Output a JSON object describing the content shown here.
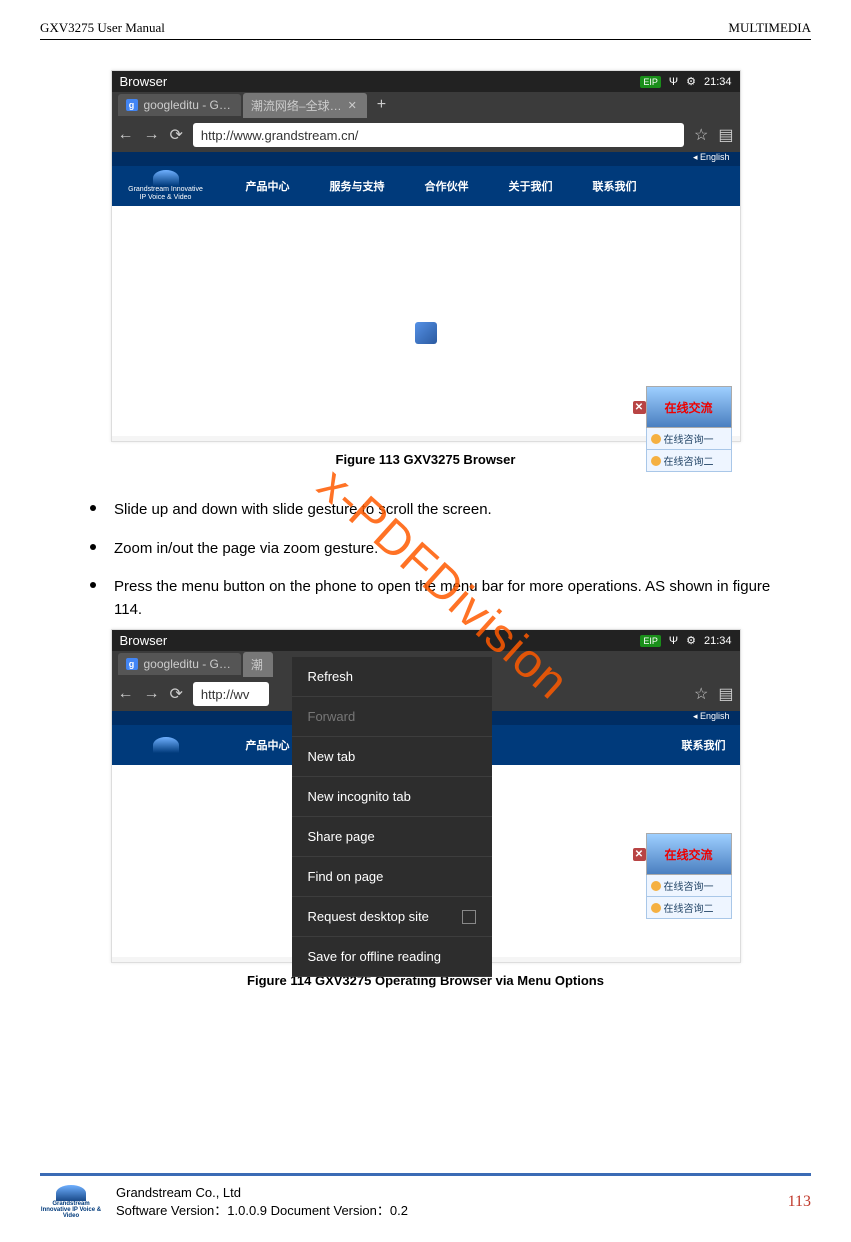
{
  "header": {
    "left": "GXV3275 User Manual",
    "right": "MULTIMEDIA"
  },
  "watermark": "x-PDFDivision",
  "screenshot1": {
    "app_title": "Browser",
    "time": "21:34",
    "eip_badge": "EIP",
    "tabs": [
      {
        "label": "googleditu - G…",
        "active": false,
        "icon": "g"
      },
      {
        "label": "潮流网络–全球…",
        "active": true
      }
    ],
    "url": "http://www.grandstream.cn/",
    "lang_label": "English",
    "site_nav": [
      "产品中心",
      "服务与支持",
      "合作伙伴",
      "关于我们",
      "联系我们"
    ],
    "logo_text": "Grandstream\nInnovative IP Voice & Video",
    "callout": {
      "title": "在线交流",
      "items": [
        "在线咨询一",
        "在线咨询二"
      ]
    }
  },
  "fig1_caption": "Figure 113 GXV3275 Browser",
  "bullets": [
    "Slide up and down with slide gesture to scroll the screen.",
    "Zoom in/out the page via zoom gesture.",
    "Press the menu button on the phone to open the menu bar for more operations. AS shown in figure 114."
  ],
  "screenshot2": {
    "app_title": "Browser",
    "time": "21:34",
    "eip_badge": "EIP",
    "tab_label": "googleditu - G…",
    "tab2_prefix": "潮",
    "url_prefix": "http://wv",
    "nav_first": "产品中心",
    "nav_last": "联系我们",
    "lang_label": "English",
    "menu": [
      {
        "label": "Refresh",
        "disabled": false
      },
      {
        "label": "Forward",
        "disabled": true
      },
      {
        "label": "New tab",
        "disabled": false
      },
      {
        "label": "New incognito tab",
        "disabled": false
      },
      {
        "label": "Share page",
        "disabled": false
      },
      {
        "label": "Find on page",
        "disabled": false
      },
      {
        "label": "Request desktop site",
        "disabled": false,
        "checkbox": true
      },
      {
        "label": "Save for offline reading",
        "disabled": false
      }
    ],
    "callout": {
      "title": "在线交流",
      "items": [
        "在线咨询一",
        "在线咨询二"
      ]
    }
  },
  "fig2_caption": "Figure 114 GXV3275 Operating Browser via Menu Options",
  "footer": {
    "company": "Grandstream Co., Ltd",
    "version_line": "Software Version：1.0.0.9 Document Version：0.2",
    "logo_text": "Grandstream\nInnovative IP Voice & Video",
    "page": "113"
  }
}
